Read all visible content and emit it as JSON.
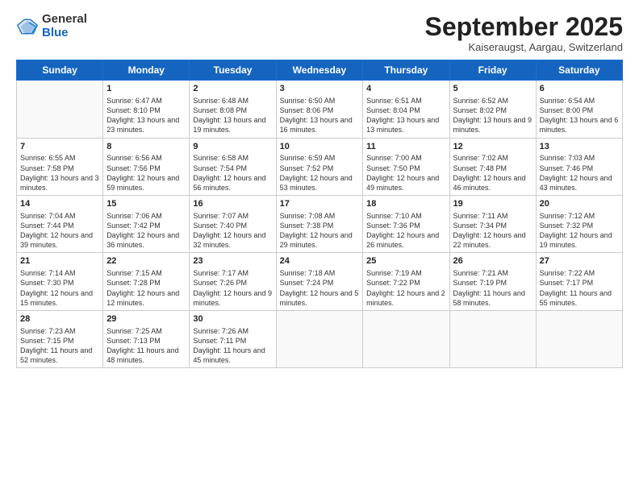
{
  "logo": {
    "general": "General",
    "blue": "Blue"
  },
  "title": "September 2025",
  "subtitle": "Kaiseraugst, Aargau, Switzerland",
  "headers": [
    "Sunday",
    "Monday",
    "Tuesday",
    "Wednesday",
    "Thursday",
    "Friday",
    "Saturday"
  ],
  "weeks": [
    [
      {
        "day": "",
        "info": ""
      },
      {
        "day": "1",
        "info": "Sunrise: 6:47 AM\nSunset: 8:10 PM\nDaylight: 13 hours\nand 23 minutes."
      },
      {
        "day": "2",
        "info": "Sunrise: 6:48 AM\nSunset: 8:08 PM\nDaylight: 13 hours\nand 19 minutes."
      },
      {
        "day": "3",
        "info": "Sunrise: 6:50 AM\nSunset: 8:06 PM\nDaylight: 13 hours\nand 16 minutes."
      },
      {
        "day": "4",
        "info": "Sunrise: 6:51 AM\nSunset: 8:04 PM\nDaylight: 13 hours\nand 13 minutes."
      },
      {
        "day": "5",
        "info": "Sunrise: 6:52 AM\nSunset: 8:02 PM\nDaylight: 13 hours\nand 9 minutes."
      },
      {
        "day": "6",
        "info": "Sunrise: 6:54 AM\nSunset: 8:00 PM\nDaylight: 13 hours\nand 6 minutes."
      }
    ],
    [
      {
        "day": "7",
        "info": "Sunrise: 6:55 AM\nSunset: 7:58 PM\nDaylight: 13 hours\nand 3 minutes."
      },
      {
        "day": "8",
        "info": "Sunrise: 6:56 AM\nSunset: 7:56 PM\nDaylight: 12 hours\nand 59 minutes."
      },
      {
        "day": "9",
        "info": "Sunrise: 6:58 AM\nSunset: 7:54 PM\nDaylight: 12 hours\nand 56 minutes."
      },
      {
        "day": "10",
        "info": "Sunrise: 6:59 AM\nSunset: 7:52 PM\nDaylight: 12 hours\nand 53 minutes."
      },
      {
        "day": "11",
        "info": "Sunrise: 7:00 AM\nSunset: 7:50 PM\nDaylight: 12 hours\nand 49 minutes."
      },
      {
        "day": "12",
        "info": "Sunrise: 7:02 AM\nSunset: 7:48 PM\nDaylight: 12 hours\nand 46 minutes."
      },
      {
        "day": "13",
        "info": "Sunrise: 7:03 AM\nSunset: 7:46 PM\nDaylight: 12 hours\nand 43 minutes."
      }
    ],
    [
      {
        "day": "14",
        "info": "Sunrise: 7:04 AM\nSunset: 7:44 PM\nDaylight: 12 hours\nand 39 minutes."
      },
      {
        "day": "15",
        "info": "Sunrise: 7:06 AM\nSunset: 7:42 PM\nDaylight: 12 hours\nand 36 minutes."
      },
      {
        "day": "16",
        "info": "Sunrise: 7:07 AM\nSunset: 7:40 PM\nDaylight: 12 hours\nand 32 minutes."
      },
      {
        "day": "17",
        "info": "Sunrise: 7:08 AM\nSunset: 7:38 PM\nDaylight: 12 hours\nand 29 minutes."
      },
      {
        "day": "18",
        "info": "Sunrise: 7:10 AM\nSunset: 7:36 PM\nDaylight: 12 hours\nand 26 minutes."
      },
      {
        "day": "19",
        "info": "Sunrise: 7:11 AM\nSunset: 7:34 PM\nDaylight: 12 hours\nand 22 minutes."
      },
      {
        "day": "20",
        "info": "Sunrise: 7:12 AM\nSunset: 7:32 PM\nDaylight: 12 hours\nand 19 minutes."
      }
    ],
    [
      {
        "day": "21",
        "info": "Sunrise: 7:14 AM\nSunset: 7:30 PM\nDaylight: 12 hours\nand 15 minutes."
      },
      {
        "day": "22",
        "info": "Sunrise: 7:15 AM\nSunset: 7:28 PM\nDaylight: 12 hours\nand 12 minutes."
      },
      {
        "day": "23",
        "info": "Sunrise: 7:17 AM\nSunset: 7:26 PM\nDaylight: 12 hours\nand 9 minutes."
      },
      {
        "day": "24",
        "info": "Sunrise: 7:18 AM\nSunset: 7:24 PM\nDaylight: 12 hours\nand 5 minutes."
      },
      {
        "day": "25",
        "info": "Sunrise: 7:19 AM\nSunset: 7:22 PM\nDaylight: 12 hours\nand 2 minutes."
      },
      {
        "day": "26",
        "info": "Sunrise: 7:21 AM\nSunset: 7:19 PM\nDaylight: 11 hours\nand 58 minutes."
      },
      {
        "day": "27",
        "info": "Sunrise: 7:22 AM\nSunset: 7:17 PM\nDaylight: 11 hours\nand 55 minutes."
      }
    ],
    [
      {
        "day": "28",
        "info": "Sunrise: 7:23 AM\nSunset: 7:15 PM\nDaylight: 11 hours\nand 52 minutes."
      },
      {
        "day": "29",
        "info": "Sunrise: 7:25 AM\nSunset: 7:13 PM\nDaylight: 11 hours\nand 48 minutes."
      },
      {
        "day": "30",
        "info": "Sunrise: 7:26 AM\nSunset: 7:11 PM\nDaylight: 11 hours\nand 45 minutes."
      },
      {
        "day": "",
        "info": ""
      },
      {
        "day": "",
        "info": ""
      },
      {
        "day": "",
        "info": ""
      },
      {
        "day": "",
        "info": ""
      }
    ]
  ]
}
